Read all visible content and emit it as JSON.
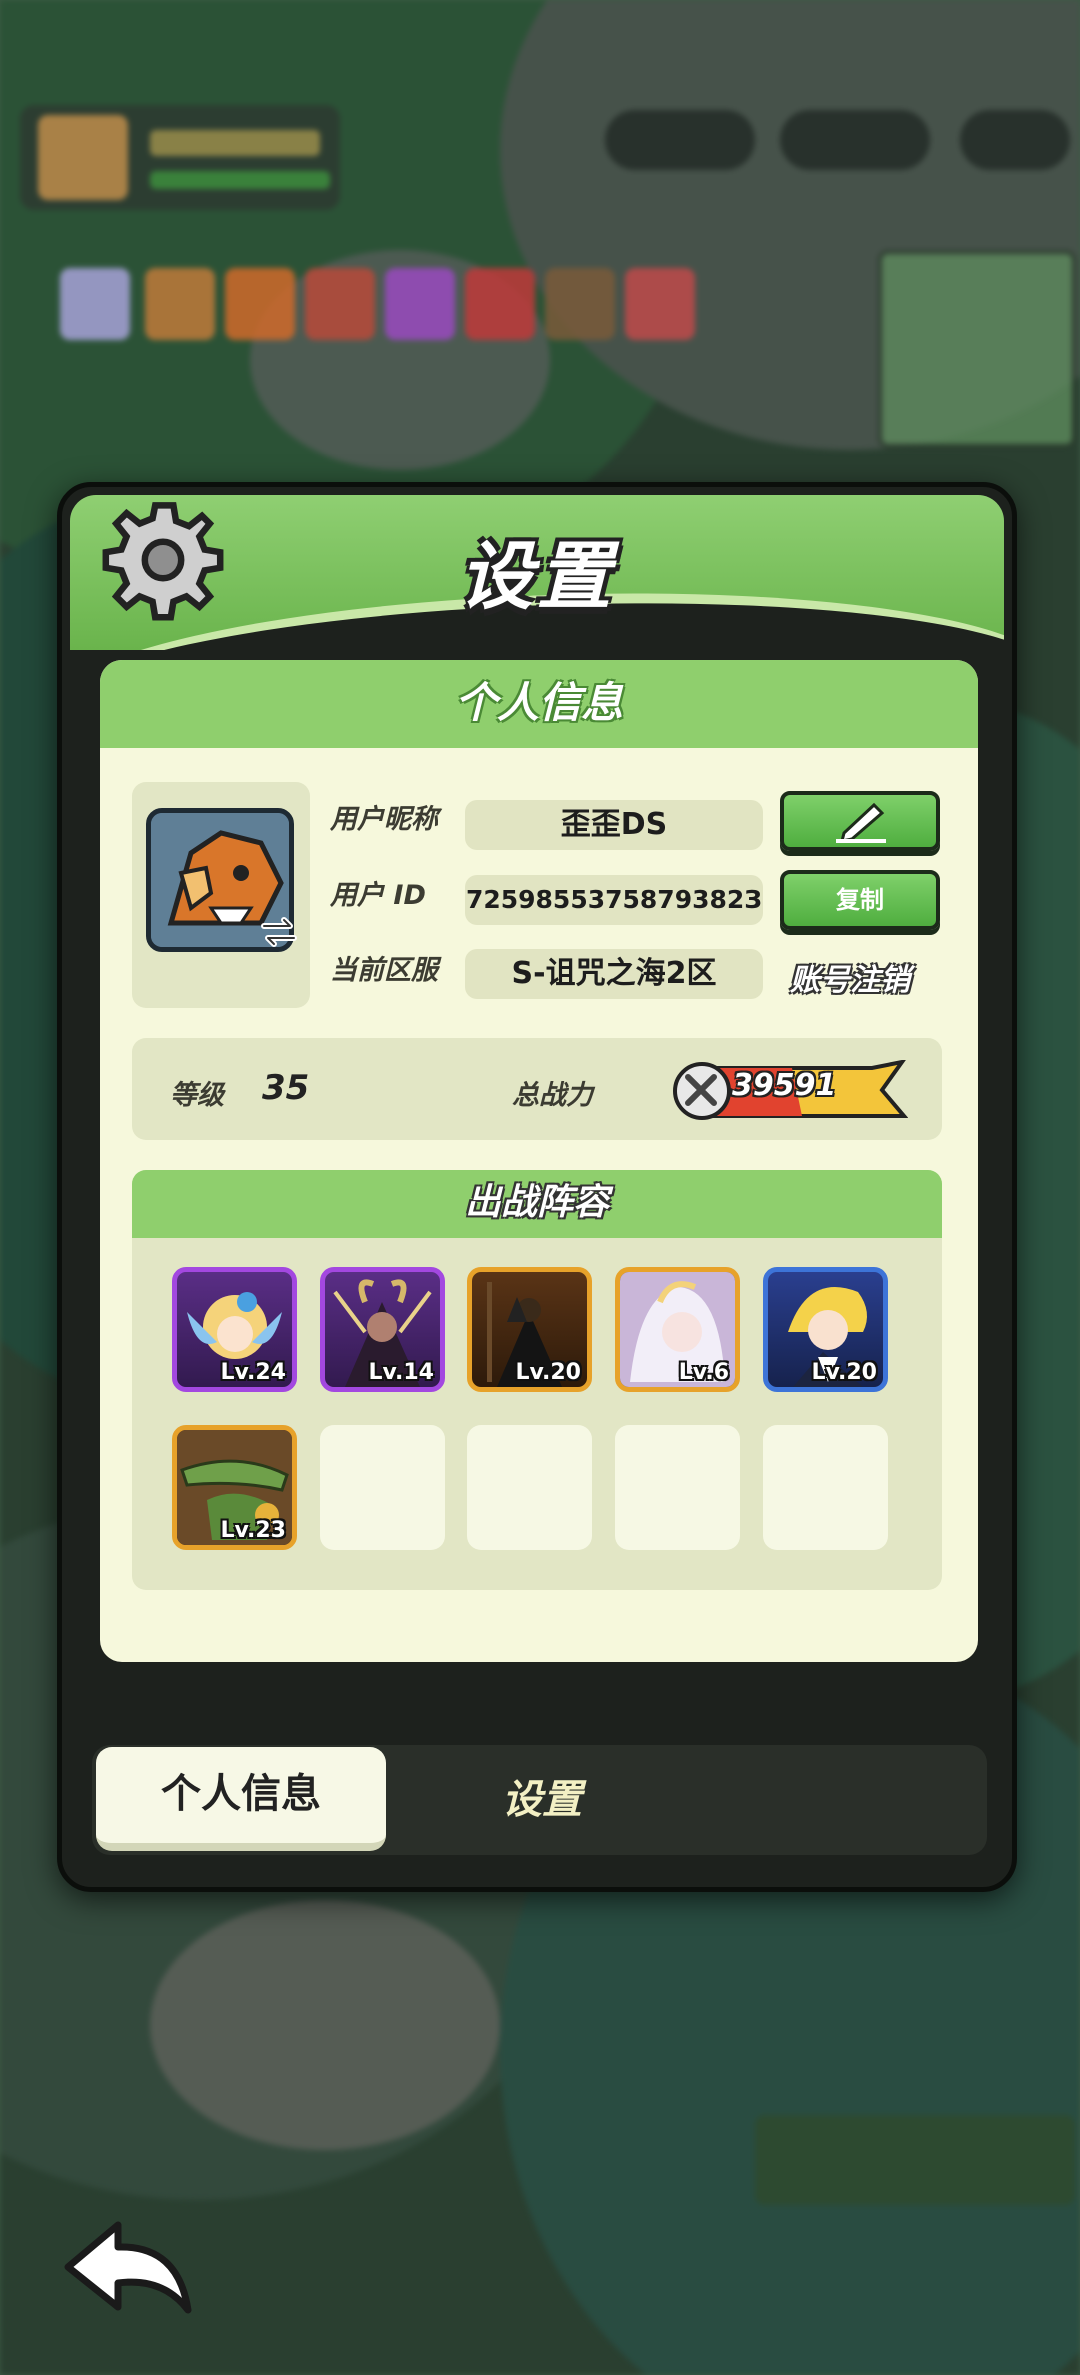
{
  "modal": {
    "title": "设置"
  },
  "panel": {
    "title": "个人信息"
  },
  "profile": {
    "nickname_label": "用户昵称",
    "nickname_value": "歪歪DS",
    "id_label": "用户 ID",
    "id_value": "7259855375879382З",
    "server_label": "当前区服",
    "server_value": "S-诅咒之海2区",
    "copy_button": "复制",
    "account_delete_link": "账号注销"
  },
  "stats": {
    "level_label": "等级",
    "level_value": "35",
    "power_label": "总战力",
    "power_value": "39591"
  },
  "lineup": {
    "title": "出战阵容",
    "heroes": [
      {
        "level": "Lv.24",
        "frame": "purple",
        "icon": "fairy-hero-portrait"
      },
      {
        "level": "Lv.14",
        "frame": "purple",
        "icon": "horned-demon-hero-portrait"
      },
      {
        "level": "Lv.20",
        "frame": "orange",
        "icon": "dark-mage-hero-portrait"
      },
      {
        "level": "Lv.6",
        "frame": "orange",
        "icon": "white-hair-hero-portrait"
      },
      {
        "level": "Lv.20",
        "frame": "blue",
        "icon": "blonde-hero-portrait"
      },
      {
        "level": "Lv.23",
        "frame": "orange",
        "icon": "crocodile-hero-portrait"
      }
    ],
    "empty_slots": 4
  },
  "tabs": [
    {
      "label": "个人信息",
      "active": true
    },
    {
      "label": "设置",
      "active": false
    }
  ],
  "colors": {
    "header_green": "#8fcf72",
    "panel_bg": "#f6f8dc",
    "button_green": "#4fae3f",
    "frame_purple": "#a348e0",
    "frame_orange": "#e7a22a",
    "frame_blue": "#3d74d8"
  }
}
